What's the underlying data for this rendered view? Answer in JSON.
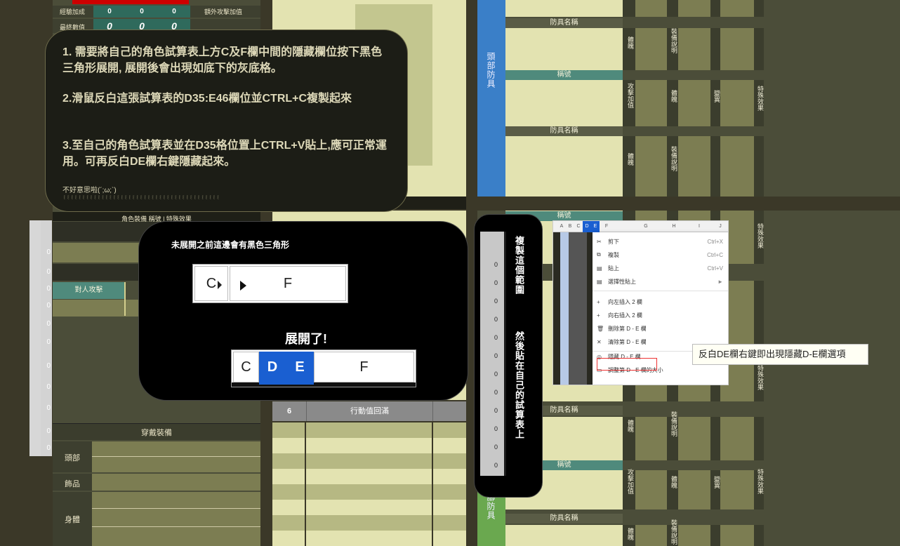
{
  "left_sheet": {
    "stat_rows": [
      {
        "label": "經驗加成",
        "values": [
          "0",
          "0",
          "0"
        ],
        "extra": "額外攻擊加值"
      },
      {
        "label": "最終數值",
        "values": [
          "0",
          "0",
          "0"
        ]
      }
    ],
    "tabs_caption": "角色裝備 稱號 | 特殊效果",
    "zeros": [
      "0",
      "0",
      "0",
      "0",
      "0",
      "0",
      "0",
      "0",
      "0",
      "0",
      "0"
    ],
    "row_to_person": "對人攻擊",
    "equip_header": "穿戴裝備",
    "equip_slots": [
      "頭部",
      "飾品",
      "身體"
    ]
  },
  "middle_sheet": {
    "row_number": "6",
    "row_label": "行動值回滿"
  },
  "right_sheet": {
    "side_heads": [
      "頭部防具",
      "腳防具"
    ],
    "name_header": "防具名稱",
    "title_header": "稱號",
    "col_labels": {
      "soul": "體魄",
      "desc": "裝備說明",
      "atk": "攻擊加值",
      "var": "變異",
      "special": "特殊效果"
    }
  },
  "callout_main": {
    "step1": "1. 需要將自己的角色試算表上方C及F欄中間的隱藏欄位按下黑色三角形展開, 展開後會出現如底下的灰底格。",
    "step2": "2.滑鼠反白這張試算表的D35:E46欄位並CTRL+C複製起來",
    "step3": "3.至自己的角色試算表並在D35格位置上CTRL+V貼上,應可正常運用。可再反白DE欄右鍵隱藏起來。",
    "apology": "不好意思啦(´;ω;`)",
    "tail": "꒰꒰꒰꒰꒰꒰꒰꒰꒰꒰꒰꒰꒰꒰꒰꒰꒰꒰꒰꒰꒰꒰꒰꒰꒰꒰꒰꒰꒰꒰꒰꒰꒰꒰꒰꒰꒰꒰꒰꒰꒰"
  },
  "callout_expand": {
    "before_caption": "未展開之前這邊會有黑色三角形",
    "before_cols": [
      "C",
      "F"
    ],
    "after_caption": "展開了!",
    "after_cols": [
      "C",
      "D",
      "E",
      "F"
    ]
  },
  "callout_copy": {
    "text_a": "複製這個範圍",
    "text_b": "然後貼在自己的試算表上",
    "zeros": [
      "0",
      "0",
      "0",
      "0",
      "0",
      "0",
      "0",
      "0",
      "0",
      "0",
      "0",
      "0"
    ]
  },
  "context_menu": {
    "col_headers": [
      "A",
      "B",
      "C",
      "D",
      "E",
      "F",
      "G",
      "H",
      "I",
      "J"
    ],
    "items": [
      {
        "icon": "scissors-icon",
        "label": "剪下",
        "shortcut": "Ctrl+X"
      },
      {
        "icon": "copy-icon",
        "label": "複製",
        "shortcut": "Ctrl+C"
      },
      {
        "icon": "paste-icon",
        "label": "貼上",
        "shortcut": "Ctrl+V"
      },
      {
        "icon": "paste-special-icon",
        "label": "選擇性貼上",
        "shortcut": "►"
      },
      {
        "icon": "plus-icon",
        "label": "向左插入 2 欄",
        "shortcut": ""
      },
      {
        "icon": "plus-icon",
        "label": "向右插入 2 欄",
        "shortcut": ""
      },
      {
        "icon": "trash-icon",
        "label": "刪除第 D - E 欄",
        "shortcut": ""
      },
      {
        "icon": "close-icon",
        "label": "清除第 D - E 欄",
        "shortcut": ""
      },
      {
        "icon": "eye-off-icon",
        "label": "隱藏 D - E 欄",
        "shortcut": ""
      },
      {
        "icon": "resize-icon",
        "label": "調整第 D - E 欄的大小",
        "shortcut": ""
      }
    ],
    "tooltip": "反白DE欄右鍵即出現隱藏D-E欄選項"
  },
  "colors": {
    "accent_blue": "#3a7fc8",
    "accent_teal": "#4f8a7c",
    "accent_green": "#6aa84f",
    "sheet_light": "#e3e3b1",
    "sheet_dark": "#4b4d39",
    "header_red": "#cc0000"
  }
}
